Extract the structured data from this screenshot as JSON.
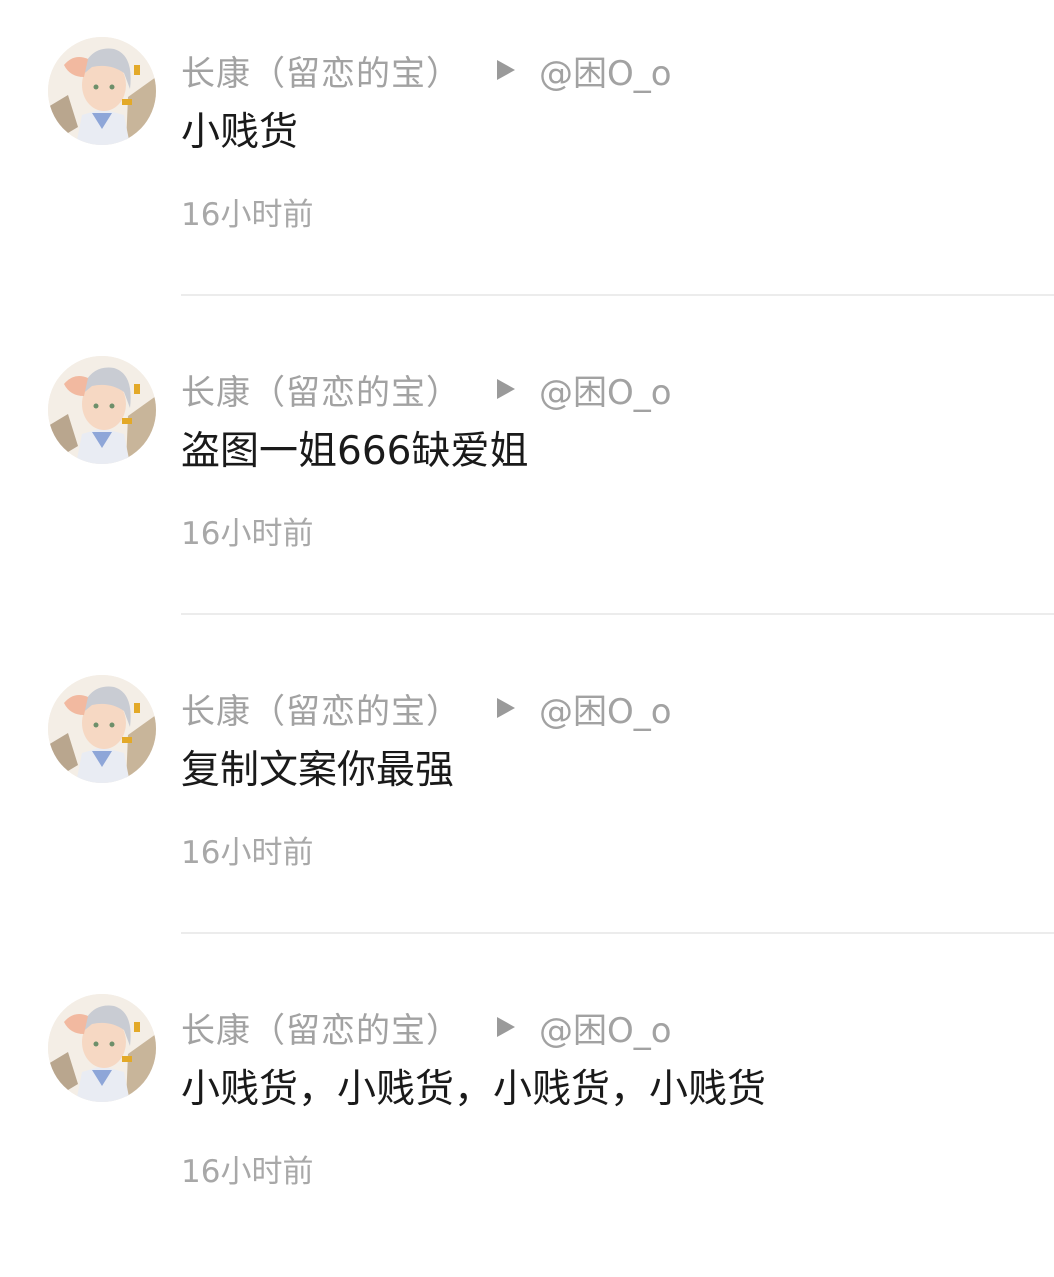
{
  "comments": [
    {
      "author": "长康（留恋的宝）",
      "reply_to": "@困O_o",
      "text": "小贱货",
      "time": "16小时前"
    },
    {
      "author": "长康（留恋的宝）",
      "reply_to": "@困O_o",
      "text": "盗图一姐666缺爱姐",
      "time": "16小时前"
    },
    {
      "author": "长康（留恋的宝）",
      "reply_to": "@困O_o",
      "text": "复制文案你最强",
      "time": "16小时前"
    },
    {
      "author": "长康（留恋的宝）",
      "reply_to": "@困O_o",
      "text": "小贱货，小贱货，小贱货，小贱货",
      "time": "16小时前"
    }
  ],
  "icons": {
    "avatar": "anime-avatar",
    "reply_arrow": "play-triangle-icon"
  },
  "colors": {
    "meta_text": "#a2a2a2",
    "body_text": "#1a1a1a",
    "divider": "#ececec"
  }
}
